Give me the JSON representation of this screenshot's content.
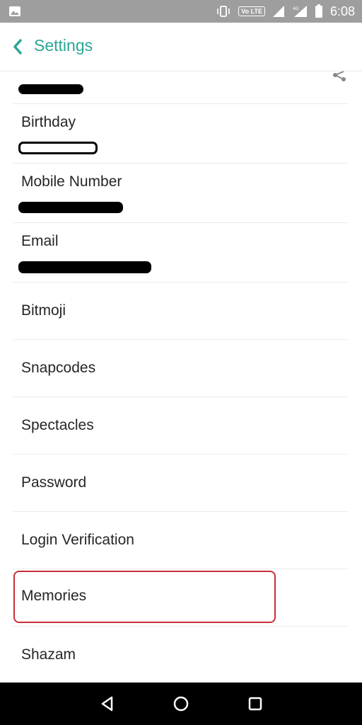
{
  "status_bar": {
    "time": "6:08",
    "network_badge": "Vo LTE",
    "icons": [
      "image-icon",
      "vibrate-icon",
      "signal-icon",
      "signal-4g-icon",
      "battery-icon"
    ]
  },
  "header": {
    "back_icon": "chevron-left-icon",
    "title": "Settings",
    "accent_color": "#2aa696"
  },
  "settings": {
    "birthday_label": "Birthday",
    "mobile_label": "Mobile Number",
    "email_label": "Email",
    "items": [
      "Bitmoji",
      "Snapcodes",
      "Spectacles",
      "Password",
      "Login Verification",
      "Memories",
      "Shazam"
    ]
  },
  "highlight": {
    "item": "Memories",
    "color": "#c62f37"
  },
  "nav_bar": {
    "buttons": [
      "back-triangle-icon",
      "home-circle-icon",
      "recents-square-icon"
    ]
  }
}
